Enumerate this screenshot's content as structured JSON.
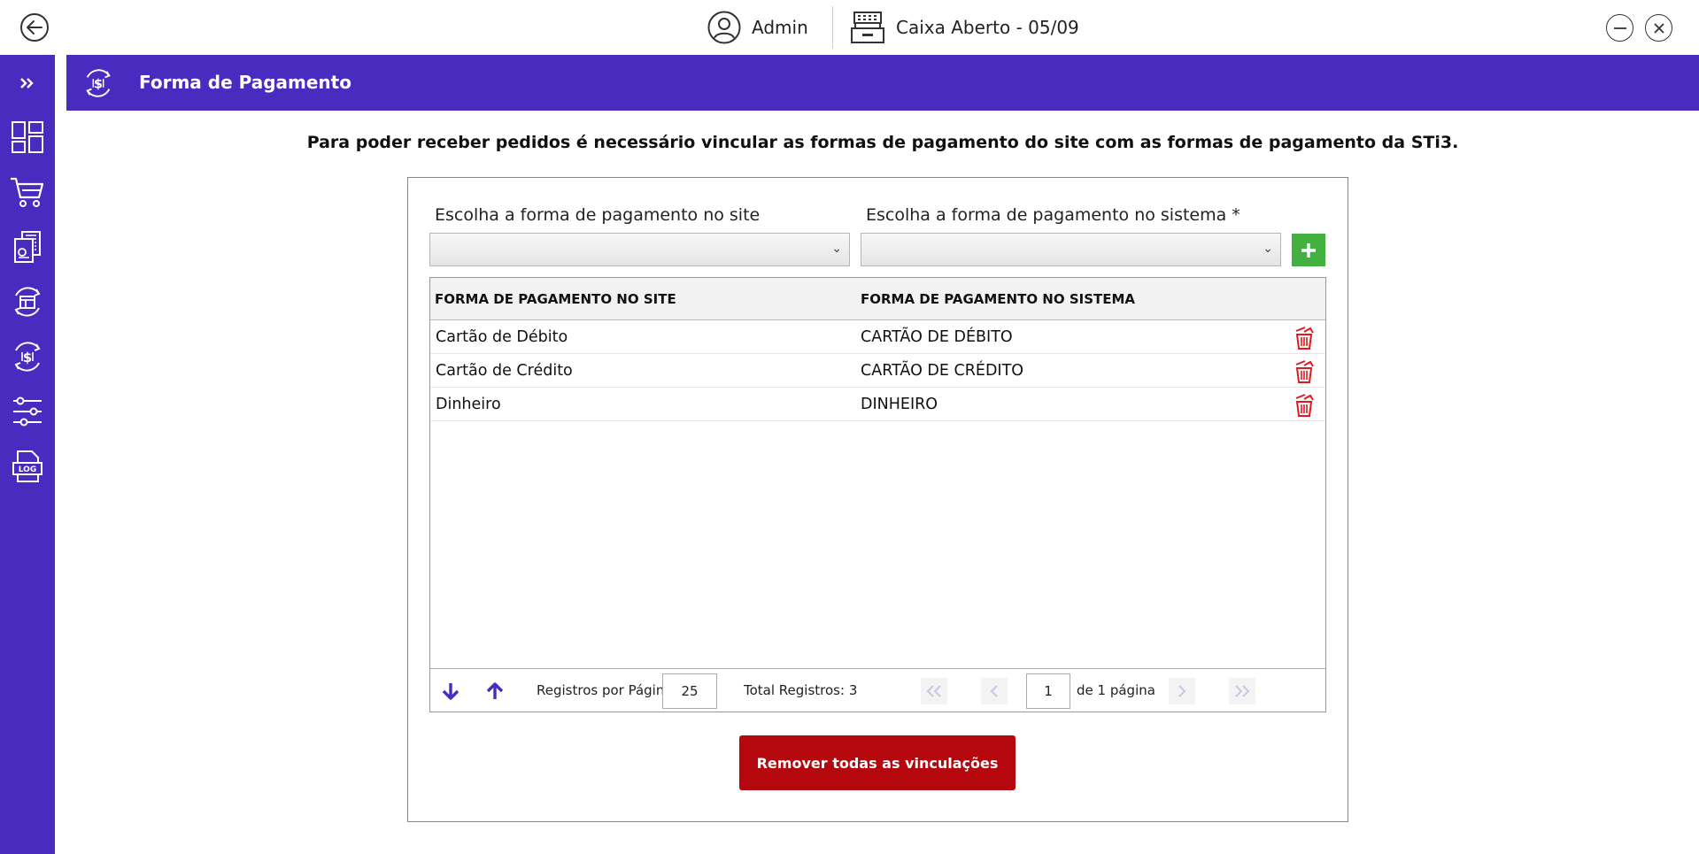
{
  "topbar": {
    "user_name": "Admin",
    "register_status": "Caixa Aberto - 05/09"
  },
  "sidebar": {
    "items": [
      {
        "icon": "double-chevron-right-icon"
      },
      {
        "icon": "dashboard-icon"
      },
      {
        "icon": "cart-icon"
      },
      {
        "icon": "documents-icon"
      },
      {
        "icon": "store-sync-icon"
      },
      {
        "icon": "payment-sync-icon"
      },
      {
        "icon": "sliders-icon"
      },
      {
        "icon": "log-file-icon"
      }
    ]
  },
  "header": {
    "title": "Forma de Pagamento"
  },
  "instruction": "Para poder receber pedidos é necessário vincular as formas de pagamento do site com as formas de pagamento da STi3.",
  "form": {
    "site_label": "Escolha a forma de pagamento no site",
    "system_label": "Escolha a forma de pagamento no sistema *",
    "site_value": "",
    "system_value": ""
  },
  "grid": {
    "headers": [
      "FORMA DE PAGAMENTO NO SITE",
      "FORMA DE PAGAMENTO NO SISTEMA"
    ],
    "rows": [
      [
        "Cartão de Débito",
        "CARTÃO DE DÉBITO"
      ],
      [
        "Cartão de Crédito",
        "CARTÃO DE CRÉDITO"
      ],
      [
        "Dinheiro",
        "DINHEIRO"
      ]
    ]
  },
  "pager": {
    "per_page_label": "Registros por Página:",
    "per_page_value": "25",
    "total_label": "Total Registros: 3",
    "page_value": "1",
    "page_suffix": "de 1 página"
  },
  "actions": {
    "remove_all": "Remover todas as vinculações"
  },
  "colors": {
    "brand": "#4a2bbf",
    "add": "#43b140",
    "danger": "#b5080e",
    "delete_icon": "#e0191f"
  }
}
